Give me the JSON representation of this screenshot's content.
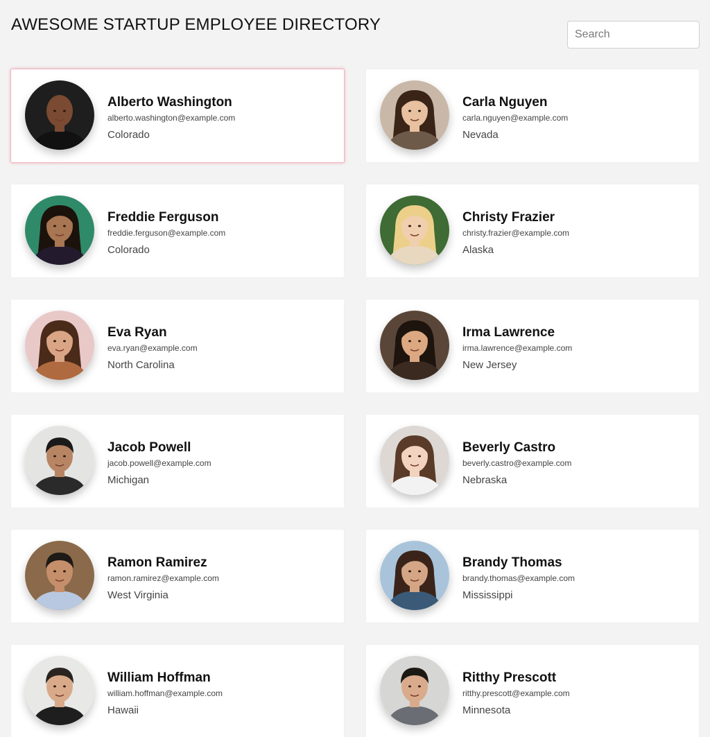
{
  "header": {
    "title": "AWESOME STARTUP EMPLOYEE DIRECTORY",
    "search_placeholder": "Search"
  },
  "employees": [
    {
      "name": "Alberto Washington",
      "email": "alberto.washington@example.com",
      "state": "Colorado",
      "selected": true,
      "avatar": {
        "bg": "#1e1e1e",
        "skin": "#7a4a32",
        "hair": "#2a1a12",
        "shirt": "#111111",
        "hair_style": "bald"
      }
    },
    {
      "name": "Carla Nguyen",
      "email": "carla.nguyen@example.com",
      "state": "Nevada",
      "selected": false,
      "avatar": {
        "bg": "#c9b8a8",
        "skin": "#e7c1a0",
        "hair": "#3a2418",
        "shirt": "#6e5a48",
        "hair_style": "long"
      }
    },
    {
      "name": "Freddie Ferguson",
      "email": "freddie.ferguson@example.com",
      "state": "Colorado",
      "selected": false,
      "avatar": {
        "bg": "#2f8a6a",
        "skin": "#a87652",
        "hair": "#1c120c",
        "shirt": "#231a2e",
        "hair_style": "long"
      }
    },
    {
      "name": "Christy Frazier",
      "email": "christy.frazier@example.com",
      "state": "Alaska",
      "selected": false,
      "avatar": {
        "bg": "#3f6b34",
        "skin": "#f0cfae",
        "hair": "#ecd08a",
        "shirt": "#e8d8c0",
        "hair_style": "long"
      }
    },
    {
      "name": "Eva Ryan",
      "email": "eva.ryan@example.com",
      "state": "North Carolina",
      "selected": false,
      "avatar": {
        "bg": "#e9c8c8",
        "skin": "#d9a584",
        "hair": "#4a2a18",
        "shirt": "#b06a40",
        "hair_style": "long"
      }
    },
    {
      "name": "Irma Lawrence",
      "email": "irma.lawrence@example.com",
      "state": "New Jersey",
      "selected": false,
      "avatar": {
        "bg": "#5a4638",
        "skin": "#dca882",
        "hair": "#1e140e",
        "shirt": "#3a2a20",
        "hair_style": "long"
      }
    },
    {
      "name": "Jacob Powell",
      "email": "jacob.powell@example.com",
      "state": "Michigan",
      "selected": false,
      "avatar": {
        "bg": "#e4e4e2",
        "skin": "#b78563",
        "hair": "#1a1a1a",
        "shirt": "#2a2a2a",
        "hair_style": "short"
      }
    },
    {
      "name": "Beverly Castro",
      "email": "beverly.castro@example.com",
      "state": "Nebraska",
      "selected": false,
      "avatar": {
        "bg": "#ddd8d4",
        "skin": "#f1d3bf",
        "hair": "#5a3a28",
        "shirt": "#f2f2f2",
        "hair_style": "long"
      }
    },
    {
      "name": "Ramon Ramirez",
      "email": "ramon.ramirez@example.com",
      "state": "West Virginia",
      "selected": false,
      "avatar": {
        "bg": "#8a6a4a",
        "skin": "#c48f6a",
        "hair": "#1e1a16",
        "shirt": "#b8c8e0",
        "hair_style": "short"
      }
    },
    {
      "name": "Brandy Thomas",
      "email": "brandy.thomas@example.com",
      "state": "Mississippi",
      "selected": false,
      "avatar": {
        "bg": "#a9c4da",
        "skin": "#d4a686",
        "hair": "#3a241a",
        "shirt": "#3a5a78",
        "hair_style": "long"
      }
    },
    {
      "name": "William Hoffman",
      "email": "william.hoffman@example.com",
      "state": "Hawaii",
      "selected": false,
      "avatar": {
        "bg": "#e8e8e6",
        "skin": "#d8aa8a",
        "hair": "#2a2420",
        "shirt": "#1e1e1e",
        "hair_style": "short"
      }
    },
    {
      "name": "Ritthy Prescott",
      "email": "ritthy.prescott@example.com",
      "state": "Minnesota",
      "selected": false,
      "avatar": {
        "bg": "#d6d6d4",
        "skin": "#d9ab8c",
        "hair": "#1c1814",
        "shirt": "#6a6e74",
        "hair_style": "short"
      }
    }
  ]
}
